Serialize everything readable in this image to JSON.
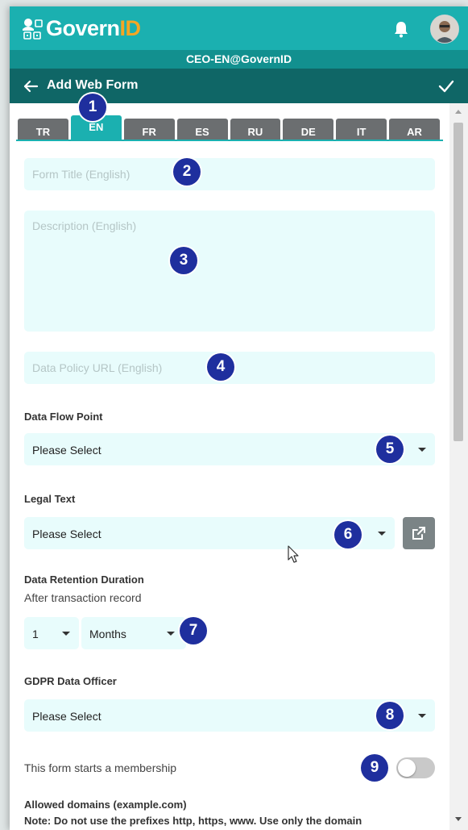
{
  "app": {
    "logo_text_main": "Govern",
    "logo_text_accent": "ID",
    "account": "CEO-EN@GovernID",
    "page_title": "Add Web Form"
  },
  "tabs": [
    {
      "label": "TR",
      "active": false
    },
    {
      "label": "EN",
      "active": true
    },
    {
      "label": "FR",
      "active": false
    },
    {
      "label": "ES",
      "active": false
    },
    {
      "label": "RU",
      "active": false
    },
    {
      "label": "DE",
      "active": false
    },
    {
      "label": "IT",
      "active": false
    },
    {
      "label": "AR",
      "active": false
    }
  ],
  "form": {
    "title_placeholder": "Form Title (English)",
    "description_placeholder": "Description (English)",
    "policy_placeholder": "Data Policy URL (English)",
    "data_flow_label": "Data Flow Point",
    "data_flow_value": "Please Select",
    "legal_text_label": "Legal Text",
    "legal_text_value": "Please Select",
    "retention_label": "Data Retention Duration",
    "retention_sublabel": "After transaction record",
    "retention_number": "1",
    "retention_unit": "Months",
    "gdpr_label": "GDPR Data Officer",
    "gdpr_value": "Please Select",
    "membership_label": "This form starts a membership",
    "membership_enabled": false,
    "domains_label": "Allowed domains (example.com)",
    "domains_note": "Note: Do not use the prefixes http, https, www. Use only the domain"
  },
  "callouts": [
    "1",
    "2",
    "3",
    "4",
    "5",
    "6",
    "7",
    "8",
    "9"
  ],
  "colors": {
    "teal": "#1bb0b0",
    "teal_dark": "#0f6666",
    "logo_accent": "#f5a623",
    "input_bg": "#e8fcfc",
    "badge": "#1f2f9e"
  },
  "icons": {
    "logo": "governid-logo-icon",
    "notifications": "bell-icon",
    "back": "arrow-left-icon",
    "save": "check-icon",
    "open_external": "external-link-icon",
    "dropdown": "caret-down-icon"
  }
}
